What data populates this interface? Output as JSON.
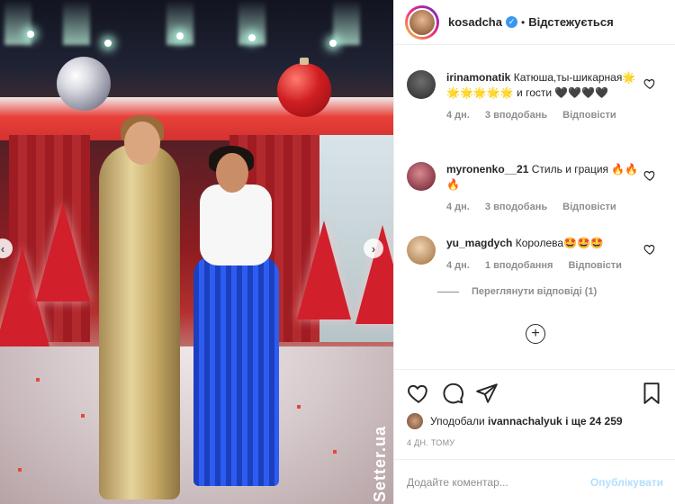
{
  "photo": {
    "watermark": "Setter.ua"
  },
  "header": {
    "username": "kosadcha",
    "separator": "•",
    "follow_status": "Відстежується"
  },
  "comments": [
    {
      "user": "irinamonatik",
      "text": "Катюша,ты-шикарная🌟🌟🌟🌟🌟🌟 и гости 🖤🖤🖤🖤",
      "age": "4 дн.",
      "likes": "3 вподобань",
      "reply": "Відповісти"
    },
    {
      "user": "myronenko__21",
      "text": "Стиль и грация 🔥🔥🔥",
      "age": "4 дн.",
      "likes": "3 вподобань",
      "reply": "Відповісти"
    },
    {
      "user": "yu_magdych",
      "text": "Королева🤩🤩🤩",
      "age": "4 дн.",
      "likes": "1 вподобання",
      "reply": "Відповісти"
    }
  ],
  "view_replies": "Переглянути відповіді (1)",
  "likes": {
    "prefix": "Уподобали",
    "user": "ivannachalyuk",
    "suffix": "і ще 24 259"
  },
  "timestamp": "4 ДН. ТОМУ",
  "add_comment": {
    "placeholder": "Додайте коментар...",
    "publish": "Опублікувати"
  },
  "colors": {
    "verified": "#3897f0",
    "publish_disabled": "#b2dffc",
    "meta_gray": "#8e8e8e"
  }
}
